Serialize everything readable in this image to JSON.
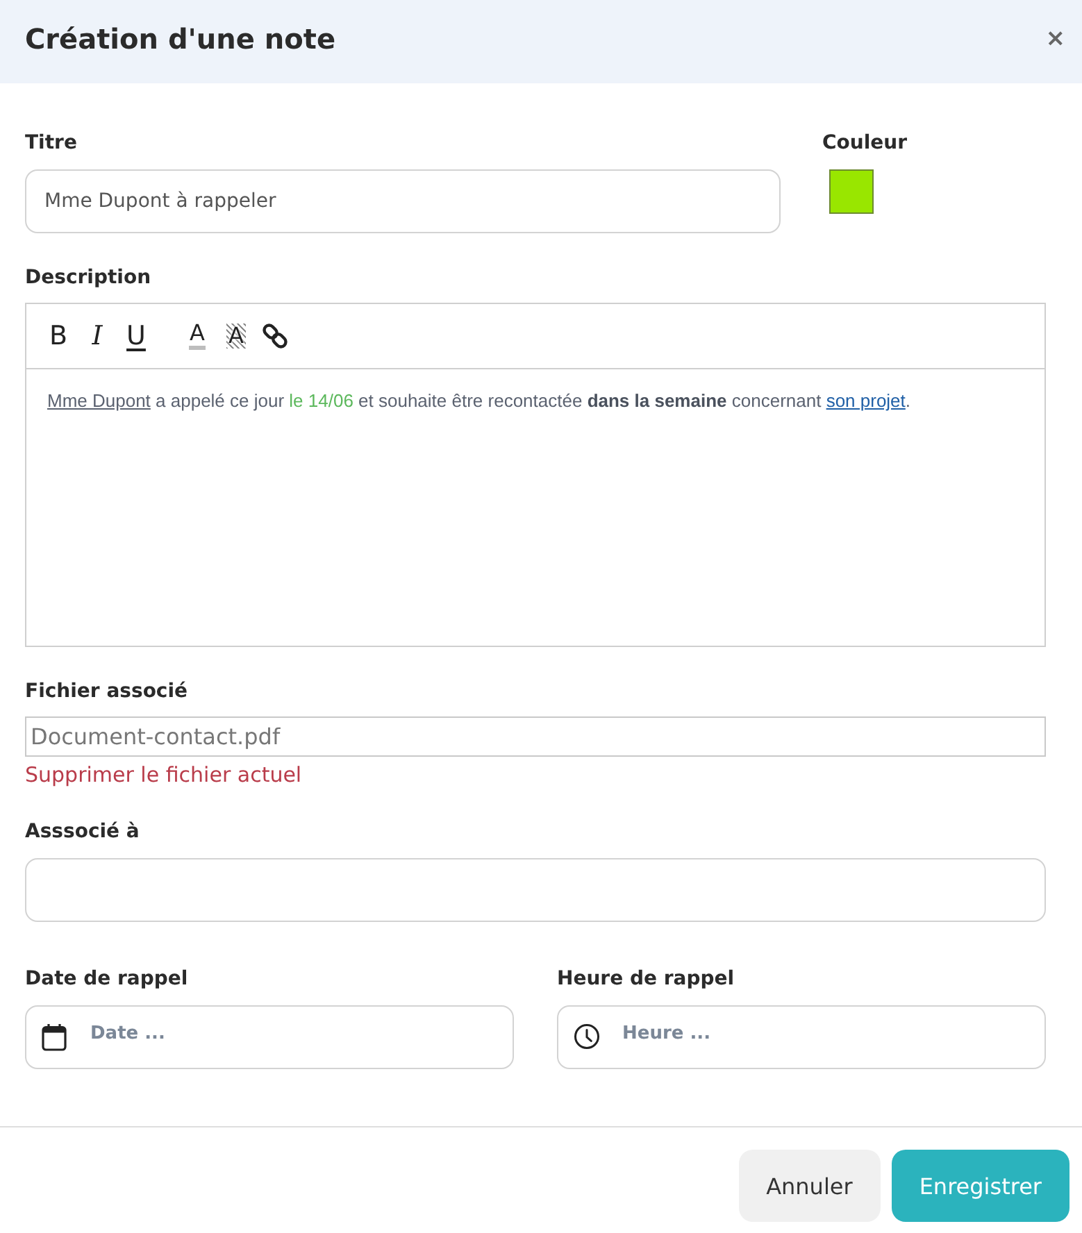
{
  "dialog": {
    "title": "Création d'une note",
    "close": "×"
  },
  "title_field": {
    "label": "Titre",
    "value": "Mme Dupont à rappeler"
  },
  "color_field": {
    "label": "Couleur",
    "color": "#99e600"
  },
  "description": {
    "label": "Description",
    "toolbar": [
      {
        "kind": "bold",
        "label": "B"
      },
      {
        "kind": "italic",
        "label": "I"
      },
      {
        "kind": "underline",
        "label": "U"
      },
      {
        "kind": "textcolor",
        "label": "A"
      },
      {
        "kind": "highlight",
        "label": "A"
      },
      {
        "kind": "link"
      }
    ],
    "segments": [
      {
        "kind": "underline",
        "text": "Mme Dupont"
      },
      {
        "kind": "plain",
        "text": " a appelé ce jour "
      },
      {
        "kind": "colored",
        "text": "le 14/06",
        "color": "#5cb85c"
      },
      {
        "kind": "plain",
        "text": " et souhaite être recontactée "
      },
      {
        "kind": "bold",
        "text": "dans la semaine"
      },
      {
        "kind": "plain",
        "text": " concernant "
      },
      {
        "kind": "link",
        "text": "son projet"
      },
      {
        "kind": "plain",
        "text": "."
      }
    ]
  },
  "file_field": {
    "label": "Fichier associé",
    "value": "Document-contact.pdf",
    "remove_link": "Supprimer le fichier actuel"
  },
  "associated_field": {
    "label": "Asssocié à"
  },
  "reminders": [
    {
      "kind": "date",
      "label": "Date de rappel",
      "placeholder": "Date ..."
    },
    {
      "kind": "time",
      "label": "Heure de rappel",
      "placeholder": "Heure ..."
    }
  ],
  "buttons": [
    {
      "kind": "secondary",
      "label": "Annuler"
    },
    {
      "kind": "primary",
      "label": "Enregistrer"
    }
  ]
}
